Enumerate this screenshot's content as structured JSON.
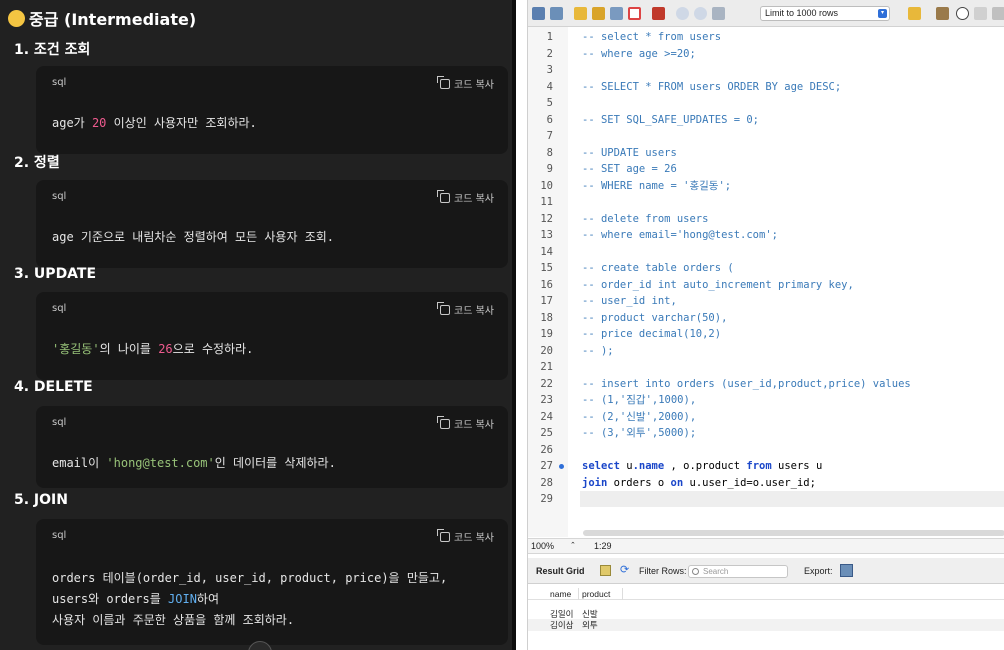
{
  "left": {
    "heading": "중급 (Intermediate)",
    "copy_label": "코드 복사",
    "sections": [
      {
        "title": "1.  조건 조회",
        "lang": "sql",
        "lines": [
          [
            {
              "t": "age가 "
            },
            {
              "t": "20",
              "c": "num"
            },
            {
              "t": " 이상인 사용자만 조회하라."
            }
          ]
        ]
      },
      {
        "title": "2.  정렬",
        "lang": "sql",
        "lines": [
          [
            {
              "t": "age 기준으로 내림차순 정렬하여 모든 사용자 조회."
            }
          ]
        ]
      },
      {
        "title": "3.  UPDATE",
        "lang": "sql",
        "lines": [
          [
            {
              "t": "'홍길동'",
              "c": "str"
            },
            {
              "t": "의 나이를 "
            },
            {
              "t": "26",
              "c": "num"
            },
            {
              "t": "으로 수정하라."
            }
          ]
        ]
      },
      {
        "title": "4.  DELETE",
        "lang": "sql",
        "lines": [
          [
            {
              "t": "email이 "
            },
            {
              "t": "'hong@test.com'",
              "c": "str"
            },
            {
              "t": "인 데이터를 삭제하라."
            }
          ]
        ]
      },
      {
        "title": "5.  JOIN",
        "lang": "sql",
        "lines": [
          [
            {
              "t": "orders 테이블(order_id, user_id, product, price)을 만들고,"
            }
          ],
          [
            {
              "t": "users와 orders를 "
            },
            {
              "t": "JOIN",
              "c": "kw"
            },
            {
              "t": "하여"
            }
          ],
          [
            {
              "t": "사용자 이름과 주문한 상품을 함께 조회하라."
            }
          ]
        ]
      }
    ]
  },
  "right": {
    "limit_select": "Limit to 1000 rows",
    "editor_lines": [
      {
        "n": "1",
        "text": "-- select * from users",
        "type": "comment"
      },
      {
        "n": "2",
        "text": "-- where age >=20;",
        "type": "comment"
      },
      {
        "n": "3",
        "text": "",
        "type": "comment"
      },
      {
        "n": "4",
        "text": "-- SELECT * FROM users ORDER BY age DESC;",
        "type": "comment"
      },
      {
        "n": "5",
        "text": "",
        "type": "comment"
      },
      {
        "n": "6",
        "text": "-- SET SQL_SAFE_UPDATES = 0;",
        "type": "comment"
      },
      {
        "n": "7",
        "text": "",
        "type": "comment"
      },
      {
        "n": "8",
        "text": "-- UPDATE users",
        "type": "comment"
      },
      {
        "n": "9",
        "text": "-- SET age = 26",
        "type": "comment"
      },
      {
        "n": "10",
        "text": "-- WHERE name = '홍길동';",
        "type": "comment"
      },
      {
        "n": "11",
        "text": "",
        "type": "comment"
      },
      {
        "n": "12",
        "text": "-- delete from users",
        "type": "comment"
      },
      {
        "n": "13",
        "text": "-- where email='hong@test.com';",
        "type": "comment"
      },
      {
        "n": "14",
        "text": "",
        "type": "comment"
      },
      {
        "n": "15",
        "text": "-- create table orders (",
        "type": "comment"
      },
      {
        "n": "16",
        "text": "-- order_id int auto_increment primary key,",
        "type": "comment"
      },
      {
        "n": "17",
        "text": "-- user_id int,",
        "type": "comment"
      },
      {
        "n": "18",
        "text": "-- product varchar(50),",
        "type": "comment"
      },
      {
        "n": "19",
        "text": "-- price decimal(10,2)",
        "type": "comment"
      },
      {
        "n": "20",
        "text": "-- );",
        "type": "comment"
      },
      {
        "n": "21",
        "text": "",
        "type": "comment"
      },
      {
        "n": "22",
        "text": "-- insert into orders (user_id,product,price) values",
        "type": "comment"
      },
      {
        "n": "23",
        "text": "-- (1,'짐갑',1000),",
        "type": "comment"
      },
      {
        "n": "24",
        "text": "-- (2,'신발',2000),",
        "type": "comment"
      },
      {
        "n": "25",
        "text": "-- (3,'외투',5000);",
        "type": "comment"
      },
      {
        "n": "26",
        "text": "",
        "type": "comment"
      },
      {
        "n": "27",
        "type": "code",
        "marker": true,
        "tokens": [
          {
            "t": "select",
            "k": true
          },
          {
            "t": " u"
          },
          {
            "t": ".name",
            "k": true
          },
          {
            "t": " , o.product "
          },
          {
            "t": "from",
            "k": true
          },
          {
            "t": " users u"
          }
        ]
      },
      {
        "n": "28",
        "type": "code",
        "tokens": [
          {
            "t": "join",
            "k": true
          },
          {
            "t": " orders o "
          },
          {
            "t": "on",
            "k": true
          },
          {
            "t": " u.user_id=o.user_id;"
          }
        ]
      },
      {
        "n": "29",
        "text": "",
        "type": "comment"
      }
    ],
    "zoom": "100%",
    "cursor_pos": "1:29",
    "result_grid_label": "Result Grid",
    "filter_rows_label": "Filter Rows:",
    "search_placeholder": "Search",
    "export_label": "Export:",
    "columns": [
      "name",
      "product"
    ],
    "rows": [
      [
        "김일이",
        "신발"
      ],
      [
        "김이삼",
        "외투"
      ]
    ]
  }
}
